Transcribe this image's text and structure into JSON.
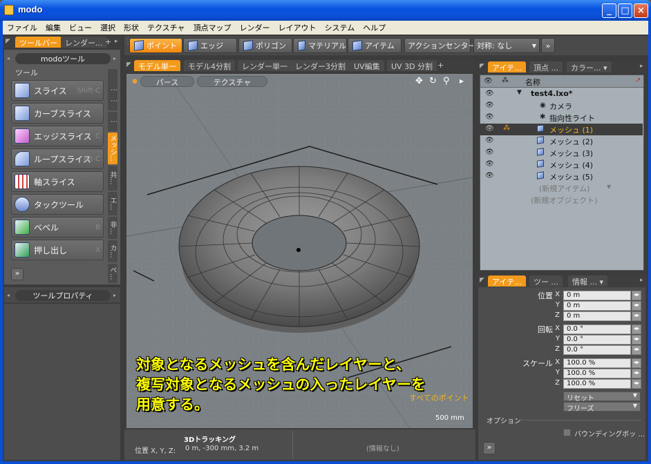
{
  "window": {
    "title": "modo",
    "min_label": "_",
    "max_label": "□",
    "close_label": "×"
  },
  "menu": [
    "ファイル",
    "編集",
    "ビュー",
    "選択",
    "形状",
    "テクスチャ",
    "頂点マップ",
    "レンダー",
    "レイアウト",
    "システム",
    "ヘルプ"
  ],
  "left_tabs": {
    "toolbar": "ツールバー",
    "render": "レンダー...",
    "plus": "+"
  },
  "left_panel": {
    "header": "modoツール",
    "section": "ツール",
    "tools": [
      {
        "label": "スライス",
        "shortcut": "Shift-C"
      },
      {
        "label": "カーブスライス",
        "shortcut": ""
      },
      {
        "label": "エッジスライス",
        "shortcut": "C"
      },
      {
        "label": "ループスライス",
        "shortcut": "Alt-C"
      },
      {
        "label": "軸スライス",
        "shortcut": ""
      },
      {
        "label": "タックツール",
        "shortcut": ""
      },
      {
        "label": "ベベル",
        "shortcut": "B"
      },
      {
        "label": "押し出し",
        "shortcut": "X"
      }
    ],
    "vtabs": [
      "メッシ...",
      "共...",
      "エ...",
      "非...",
      "カ...",
      "ペ..."
    ],
    "more": "»",
    "tool_props": "ツールプロパティ"
  },
  "top_toolbar": {
    "buttons": [
      "ポイント",
      "エッジ",
      "ポリゴン",
      "マテリアル",
      "アイテム"
    ],
    "action_center": "アクションセンター ▾",
    "symmetry": "対称: なし",
    "more": "»"
  },
  "view_tabs": [
    "モデル単一",
    "モデル4分割",
    "レンダー単一",
    "レンダー3分割",
    "UV編集",
    "UV 3D 分割",
    "+"
  ],
  "viewport": {
    "persp": "パース",
    "texture": "テクスチャ",
    "status_points": "すべてのポイント",
    "scale": "500 mm",
    "icons": [
      "✥",
      "↻",
      "⚲",
      "▸"
    ]
  },
  "caption": [
    "対象となるメッシュを含んだレイヤーと、",
    "複写対象となるメッシュの入ったレイヤーを",
    "用意する。"
  ],
  "bottom_status": {
    "title": "3Dトラッキング",
    "pos_label": "位置 X, Y, Z:",
    "pos_value": "0 m, -300 mm, 3.2 m",
    "info": "(情報なし)"
  },
  "item_list": {
    "tabs": [
      "アイテ...",
      "頂点 ...",
      "カラー... ▾"
    ],
    "col_name": "名称",
    "rows": [
      "test4.lxo*",
      "カメラ",
      "指向性ライト",
      "メッシュ (1)",
      "メッシュ (2)",
      "メッシュ (3)",
      "メッシュ (4)",
      "メッシュ (5)"
    ],
    "new_item": "(新規アイテム)",
    "new_object": "(新規オブジェクト)"
  },
  "properties": {
    "tabs": [
      "アイテ...",
      "ツー ...",
      "情報 ... ▾"
    ],
    "position_label": "位置",
    "rotation_label": "回転",
    "scale_label": "スケール",
    "axes": [
      "X",
      "Y",
      "Z"
    ],
    "position": [
      "0 m",
      "0 m",
      "0 m"
    ],
    "rotation": [
      "0.0 °",
      "0.0 °",
      "0.0 °"
    ],
    "scale": [
      "100.0 %",
      "100.0 %",
      "100.0 %"
    ],
    "reset": "リセット",
    "freeze": "フリーズ",
    "options_label": "オプション",
    "bounding_box": "バウンディングボッ ...",
    "more": "»"
  },
  "colors": {
    "accent": "#f39a1c",
    "caption": "#ffff00",
    "titlebar": "#0a54e0"
  }
}
